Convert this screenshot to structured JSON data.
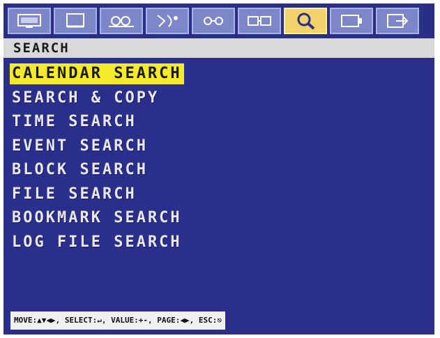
{
  "toolbar": {
    "tabs": [
      {
        "icon": "monitor-icon",
        "active": false
      },
      {
        "icon": "screen-icon",
        "active": false
      },
      {
        "icon": "camera-icon",
        "active": false
      },
      {
        "icon": "motion-icon",
        "active": false
      },
      {
        "icon": "record-icon",
        "active": false
      },
      {
        "icon": "network-icon",
        "active": false
      },
      {
        "icon": "search-icon",
        "active": true
      },
      {
        "icon": "device-icon",
        "active": false
      },
      {
        "icon": "exit-icon",
        "active": false
      }
    ]
  },
  "header": {
    "title": "SEARCH"
  },
  "menu": {
    "items": [
      {
        "label": "CALENDAR SEARCH",
        "selected": true
      },
      {
        "label": "SEARCH & COPY",
        "selected": false
      },
      {
        "label": "TIME SEARCH",
        "selected": false
      },
      {
        "label": "EVENT SEARCH",
        "selected": false
      },
      {
        "label": "BLOCK SEARCH",
        "selected": false
      },
      {
        "label": "FILE SEARCH",
        "selected": false
      },
      {
        "label": "BOOKMARK SEARCH",
        "selected": false
      },
      {
        "label": "LOG FILE SEARCH",
        "selected": false
      }
    ]
  },
  "help": {
    "text": "MOVE:▲▼◀▶, SELECT:↵, VALUE:+-, PAGE:◀▶, ESC:⎋"
  },
  "colors": {
    "background": "#2b2f8c",
    "highlight": "#f4ea2a",
    "header_bar": "#d9d9d9",
    "tab": "#7c86c8",
    "tab_active": "#f2d26a"
  }
}
